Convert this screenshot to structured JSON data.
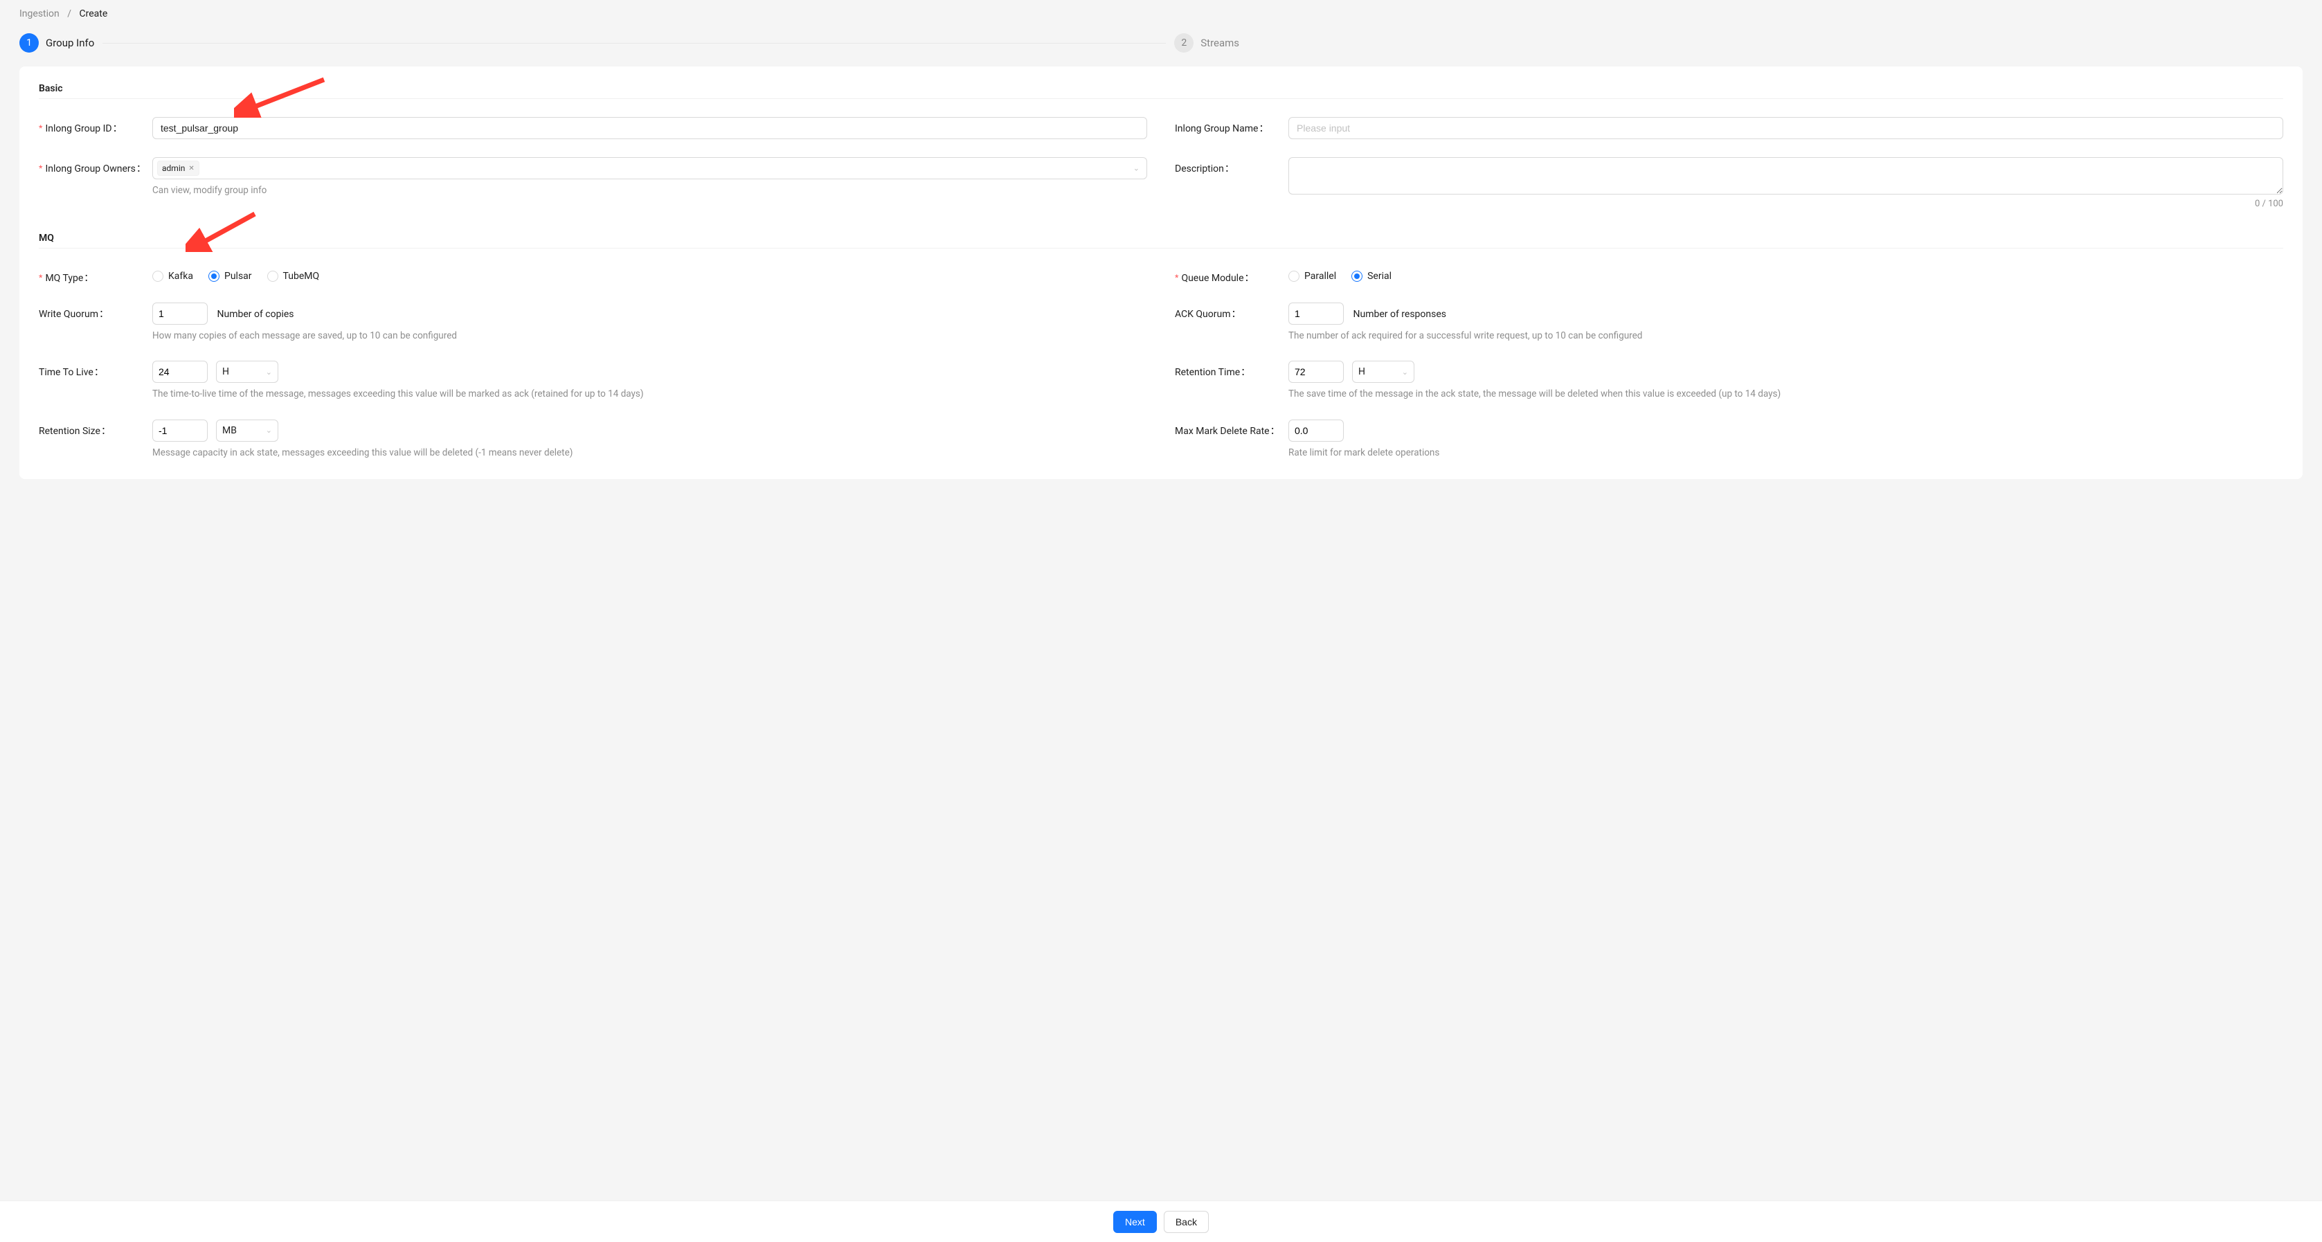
{
  "breadcrumb": {
    "root": "Ingestion",
    "current": "Create"
  },
  "steps": {
    "s1_num": "1",
    "s1_label": "Group Info",
    "s2_num": "2",
    "s2_label": "Streams"
  },
  "section": {
    "basic": "Basic",
    "mq": "MQ"
  },
  "labels": {
    "group_id": "Inlong Group ID",
    "group_name": "Inlong Group Name",
    "owners": "Inlong Group Owners",
    "description": "Description",
    "mq_type": "MQ Type",
    "queue_module": "Queue Module",
    "write_quorum": "Write Quorum",
    "ack_quorum": "ACK Quorum",
    "ttl": "Time To Live",
    "retention_time": "Retention Time",
    "retention_size": "Retention Size",
    "max_mark_delete_rate": "Max Mark Delete Rate"
  },
  "values": {
    "group_id": "test_pulsar_group",
    "group_name": "",
    "group_name_placeholder": "Please input",
    "owners_tag": "admin",
    "description": "",
    "char_count": "0 / 100",
    "write_quorum": "1",
    "write_quorum_hint": "Number of copies",
    "ack_quorum": "1",
    "ack_quorum_hint": "Number of responses",
    "ttl": "24",
    "ttl_unit": "H",
    "retention_time": "72",
    "retention_time_unit": "H",
    "retention_size": "-1",
    "retention_size_unit": "MB",
    "max_mark_delete_rate": "0.0"
  },
  "help": {
    "owners": "Can view, modify group info",
    "write_quorum": "How many copies of each message are saved, up to 10 can be configured",
    "ack_quorum": "The number of ack required for a successful write request, up to 10 can be configured",
    "ttl": "The time-to-live time of the message, messages exceeding this value will be marked as ack (retained for up to 14 days)",
    "retention_time": "The save time of the message in the ack state, the message will be deleted when this value is exceeded (up to 14 days)",
    "retention_size": "Message capacity in ack state, messages exceeding this value will be deleted (-1 means never delete)",
    "max_mark_delete_rate": "Rate limit for mark delete operations"
  },
  "radios": {
    "mq_kafka": "Kafka",
    "mq_pulsar": "Pulsar",
    "mq_tubemq": "TubeMQ",
    "qm_parallel": "Parallel",
    "qm_serial": "Serial"
  },
  "buttons": {
    "next": "Next",
    "back": "Back"
  },
  "colors": {
    "primary": "#1677ff",
    "arrow": "#ff3b30"
  }
}
